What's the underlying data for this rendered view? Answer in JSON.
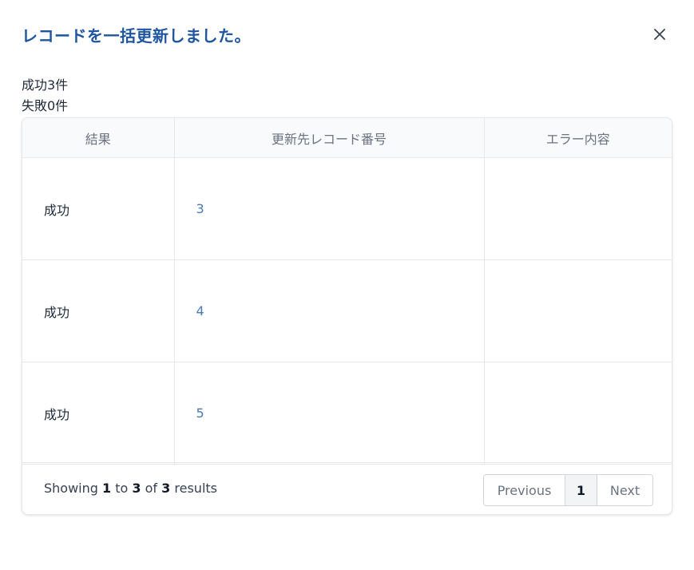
{
  "dialog": {
    "title": "レコードを一括更新しました。",
    "close_icon": "close-icon"
  },
  "summary": {
    "success": "成功3件",
    "failure": "失敗0件"
  },
  "table": {
    "headers": [
      "結果",
      "更新先レコード番号",
      "エラー内容"
    ],
    "rows": [
      {
        "result": "成功",
        "record": "3",
        "error": ""
      },
      {
        "result": "成功",
        "record": "4",
        "error": ""
      },
      {
        "result": "成功",
        "record": "5",
        "error": ""
      }
    ]
  },
  "pagination": {
    "showing_prefix": "Showing",
    "from": "1",
    "to_word": "to",
    "to": "3",
    "of_word": "of",
    "total": "3",
    "results_word": "results",
    "previous": "Previous",
    "current_page": "1",
    "next": "Next"
  },
  "colors": {
    "title": "#1e56a0",
    "link": "#4a7ab8"
  }
}
